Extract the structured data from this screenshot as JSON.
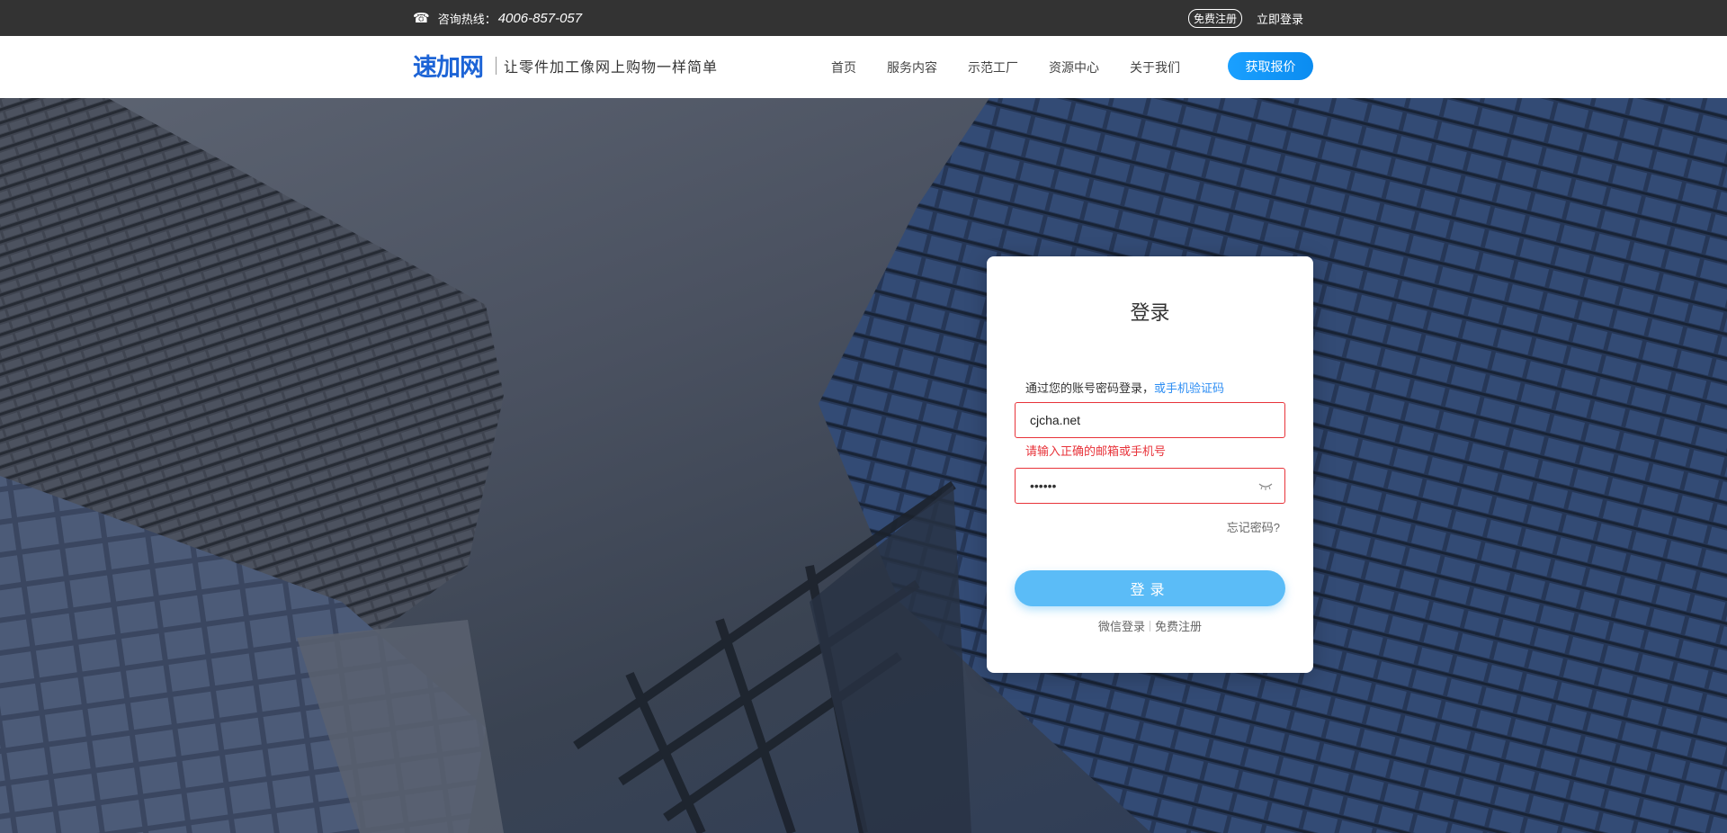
{
  "topbar": {
    "hotline_label": "咨询热线：",
    "hotline_number": "4006-857-057",
    "register_label": "免费注册",
    "login_label": "立即登录"
  },
  "header": {
    "logo_text": "速加网",
    "slogan": "让零件加工像网上购物一样简单",
    "nav": [
      "首页",
      "服务内容",
      "示范工厂",
      "资源中心",
      "关于我们"
    ],
    "quote_button": "获取报价"
  },
  "login": {
    "title": "登录",
    "hint": "通过您的账号密码登录，",
    "alt_method_link": "或手机验证码",
    "account_value": "cjcha.net",
    "account_error": "请输入正确的邮箱或手机号",
    "password_value": "••••••",
    "forgot_label": "忘记密码?",
    "submit_label": "登录",
    "wechat_login": "微信登录",
    "register": "免费注册"
  },
  "colors": {
    "accent": "#1aa0ff",
    "error": "#e8333a",
    "link": "#2c8df3",
    "submit": "#5bbcf7"
  }
}
